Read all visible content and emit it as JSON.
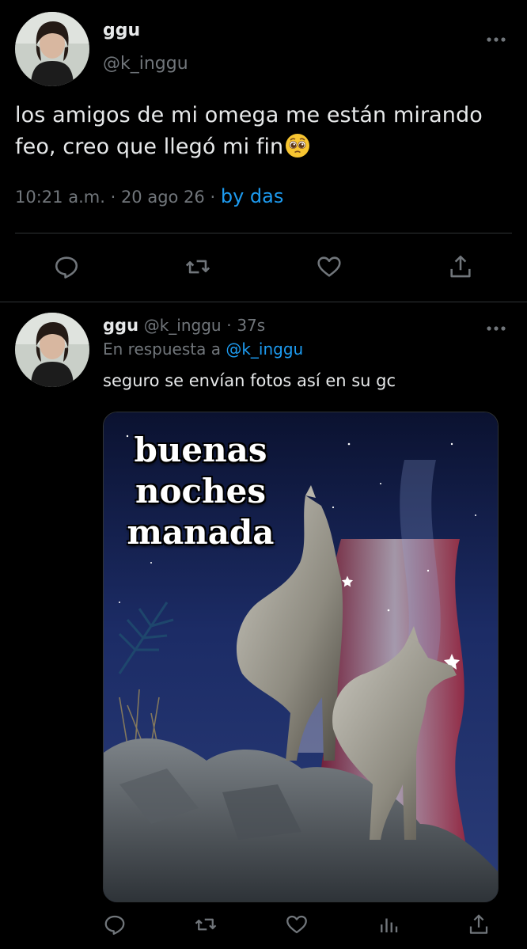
{
  "main_tweet": {
    "display_name": "ggu",
    "handle": "@k_inggu",
    "text": "los amigos de mi omega me están mirando feo, creo que llegó mi fin",
    "emoji": "pleading-face",
    "time": "10:21 a.m.",
    "date": "20 ago 26",
    "source": "by das",
    "separator": "·"
  },
  "reply_tweet": {
    "display_name": "ggu",
    "handle": "@k_inggu",
    "age": "37s",
    "separator": "·",
    "reply_prefix": "En respuesta a",
    "reply_mention": "@k_inggu",
    "text": "seguro se envían fotos así en su gc",
    "image_caption_lines": [
      "buenas",
      "noches",
      "manada"
    ],
    "image_subject": "two wolves on rocks under a starry night sky"
  },
  "icons": {
    "more": "more-horizontal-icon",
    "reply": "reply-icon",
    "retweet": "retweet-icon",
    "like": "heart-icon",
    "views": "analytics-icon",
    "share": "share-icon"
  },
  "colors": {
    "background": "#000000",
    "text": "#e7e9ea",
    "muted": "#71767b",
    "accent": "#1d9bf0",
    "divider": "#2f3336"
  }
}
